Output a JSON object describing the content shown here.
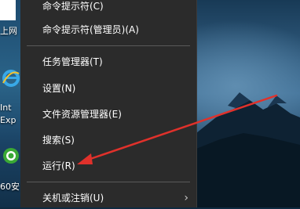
{
  "desktop": {
    "icons": [
      {
        "label": "上网"
      },
      {
        "label": "Int"
      },
      {
        "label": "Exp"
      },
      {
        "label": "60安"
      }
    ]
  },
  "context_menu": {
    "items": [
      {
        "label": "命令提示符(C)"
      },
      {
        "label": "命令提示符(管理员)(A)"
      },
      {
        "label": "任务管理器(T)"
      },
      {
        "label": "设置(N)"
      },
      {
        "label": "文件资源管理器(E)"
      },
      {
        "label": "搜索(S)"
      },
      {
        "label": "运行(R)"
      },
      {
        "label": "关机或注销(U)"
      }
    ],
    "submenu_chevron": "›"
  },
  "annotation": {
    "arrow_color": "#e0312b"
  }
}
